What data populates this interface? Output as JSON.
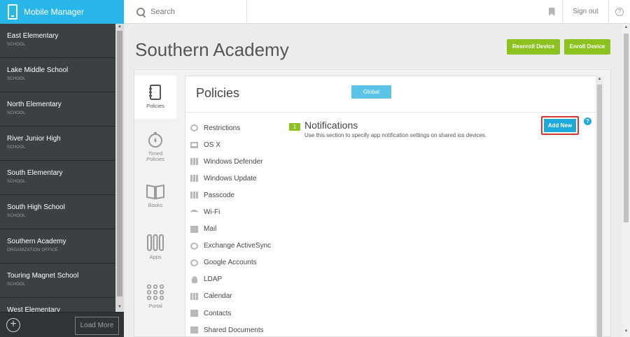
{
  "app": {
    "title": "Mobile Manager"
  },
  "sidebar": {
    "schools": [
      {
        "name": "East Elementary",
        "type": "SCHOOL"
      },
      {
        "name": "Lake Middle School",
        "type": "SCHOOL"
      },
      {
        "name": "North Elementary",
        "type": "SCHOOL"
      },
      {
        "name": "River Junior High",
        "type": "SCHOOL"
      },
      {
        "name": "South Elementary",
        "type": "SCHOOL"
      },
      {
        "name": "South High School",
        "type": "SCHOOL"
      },
      {
        "name": "Southern Academy",
        "type": "ORGANIZATION OFFICE"
      },
      {
        "name": "Touring Magnet School",
        "type": "SCHOOL"
      },
      {
        "name": "West Elementary",
        "type": ""
      }
    ],
    "add_symbol": "+",
    "load_more_label": "Load More"
  },
  "topbar": {
    "search_placeholder": "Search",
    "signout_label": "Sign out",
    "help_symbol": "?"
  },
  "page": {
    "title": "Southern Academy",
    "reenroll_label": "Reenroll Device",
    "enroll_label": "Enroll Device"
  },
  "nav": {
    "items": [
      {
        "label": "Policies",
        "icon": "notebook-icon"
      },
      {
        "label": "Timed Policies",
        "icon": "timer-icon"
      },
      {
        "label": "Books",
        "icon": "book-icon"
      },
      {
        "label": "Apps",
        "icon": "apps-tools-icon"
      },
      {
        "label": "Portal",
        "icon": "grid-dots-icon"
      }
    ]
  },
  "policies": {
    "title": "Policies",
    "scope_button": "Global",
    "items": [
      {
        "label": "Restrictions",
        "icon": "ban-icon"
      },
      {
        "label": "OS X",
        "icon": "monitor-icon"
      },
      {
        "label": "Windows Defender",
        "icon": "grid-icon"
      },
      {
        "label": "Windows Update",
        "icon": "grid-icon"
      },
      {
        "label": "Passcode",
        "icon": "keypad-icon"
      },
      {
        "label": "Wi-Fi",
        "icon": "wifi-icon"
      },
      {
        "label": "Mail",
        "icon": "mail-icon"
      },
      {
        "label": "Exchange ActiveSync",
        "icon": "sync-icon"
      },
      {
        "label": "Google Accounts",
        "icon": "google-icon"
      },
      {
        "label": "LDAP",
        "icon": "user-icon"
      },
      {
        "label": "Calendar",
        "icon": "calendar-icon"
      },
      {
        "label": "Contacts",
        "icon": "contacts-icon"
      },
      {
        "label": "Shared Documents",
        "icon": "document-icon"
      }
    ]
  },
  "notifications": {
    "count": "1",
    "title": "Notifications",
    "description": "Use this section to specify app notification settings on shared ios devices.",
    "add_label": "Add New",
    "help_symbol": "?"
  },
  "colors": {
    "brand": "#29b6e8",
    "green": "#8cc21f",
    "sidebar": "#2f3437",
    "add_button": "#1da9d9",
    "highlight": "#dd3333"
  }
}
